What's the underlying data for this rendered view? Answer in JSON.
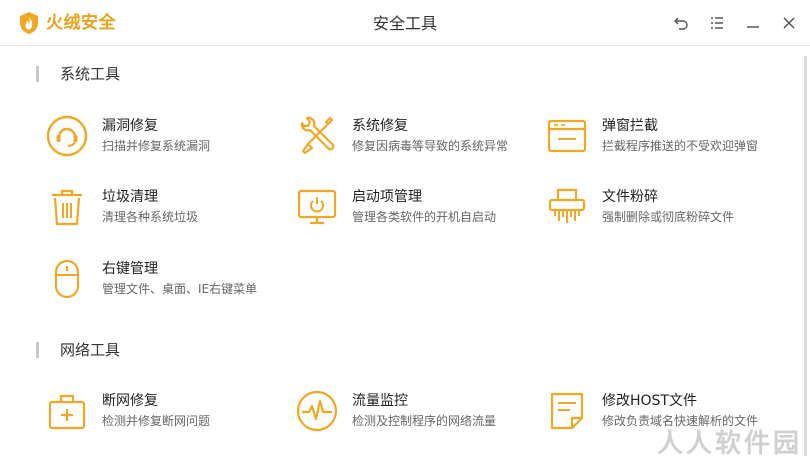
{
  "app": {
    "brand": "火绒安全",
    "title": "安全工具"
  },
  "colors": {
    "accent": "#e8a21a",
    "icon": "#f0a824",
    "text": "#333333",
    "subtext": "#666666"
  },
  "window_controls": [
    {
      "icon": "back-icon"
    },
    {
      "icon": "menu-icon"
    },
    {
      "icon": "minimize-icon"
    },
    {
      "icon": "close-icon"
    }
  ],
  "sections": [
    {
      "title": "系统工具",
      "tools": [
        {
          "name": "漏洞修复",
          "desc": "扫描并修复系统漏洞",
          "icon": "vulnerability-icon"
        },
        {
          "name": "系统修复",
          "desc": "修复因病毒等导致的系统异常",
          "icon": "wrench-screwdriver-icon"
        },
        {
          "name": "弹窗拦截",
          "desc": "拦截程序推送的不受欢迎弹窗",
          "icon": "popup-window-icon"
        },
        {
          "name": "垃圾清理",
          "desc": "清理各种系统垃圾",
          "icon": "trash-icon"
        },
        {
          "name": "启动项管理",
          "desc": "管理各类软件的开机自启动",
          "icon": "monitor-power-icon"
        },
        {
          "name": "文件粉碎",
          "desc": "强制删除或彻底粉碎文件",
          "icon": "shredder-icon"
        },
        {
          "name": "右键管理",
          "desc": "管理文件、桌面、IE右键菜单",
          "icon": "mouse-icon"
        }
      ]
    },
    {
      "title": "网络工具",
      "tools": [
        {
          "name": "断网修复",
          "desc": "检测并修复断网问题",
          "icon": "network-kit-icon"
        },
        {
          "name": "流量监控",
          "desc": "检测及控制程序的网络流量",
          "icon": "traffic-monitor-icon"
        },
        {
          "name": "修改HOST文件",
          "desc": "修改负责域名快速解析的文件",
          "icon": "host-file-icon"
        }
      ]
    }
  ],
  "watermark": "人人软件园"
}
